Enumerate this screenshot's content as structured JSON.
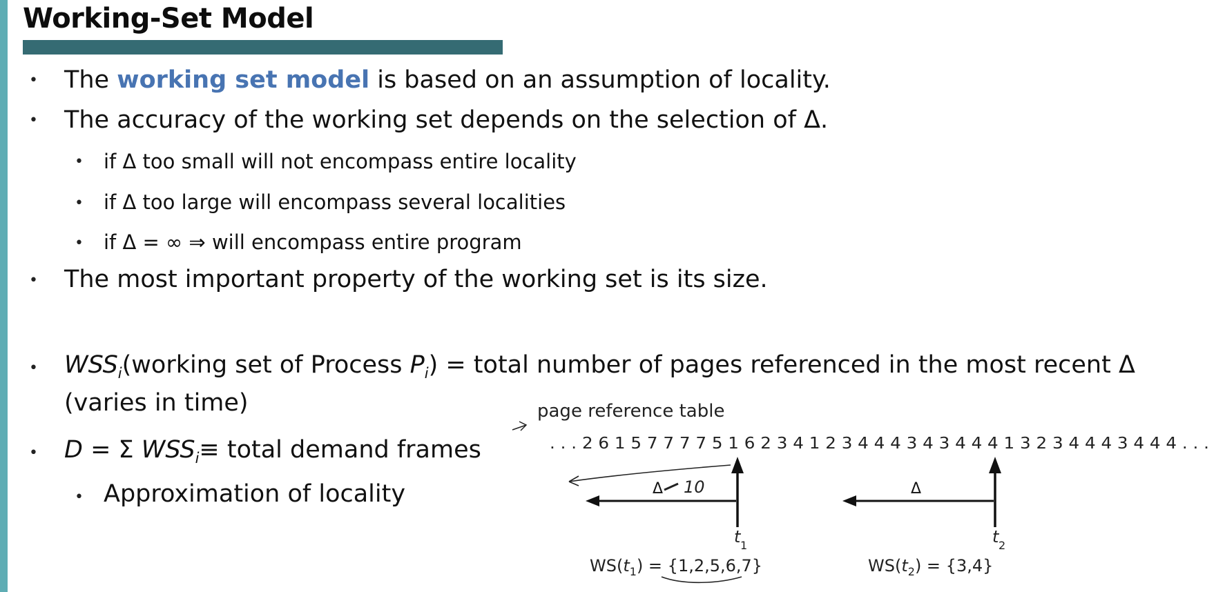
{
  "slide": {
    "title": "Working-Set Model",
    "accent_color": "#4874b2",
    "title_bar_color": "#356b73",
    "stripe_color": "#5fadb4"
  },
  "bullets": [
    {
      "pre": "The ",
      "highlight": "working set model",
      "post": " is based on an assumption of locality."
    },
    {
      "text": "The accuracy of the working set depends on the selection of Δ."
    }
  ],
  "sub_bullets": [
    "if Δ too small will not encompass entire locality",
    "if Δ too large will encompass several localities",
    "if Δ = ∞ ⇒ will encompass entire program"
  ],
  "size_bullet": "The most important property of the working set is its size.",
  "wss_bullet": {
    "wss": "WSS",
    "i": "i",
    "a": "(working set of Process ",
    "p": "P",
    "b": ") = total number of pages referenced in the most recent Δ",
    "line2": "(varies in time)"
  },
  "demand_bullet": {
    "d": "D",
    "eq": " = Σ ",
    "wss": "WSS",
    "i": "i",
    "rest": "≡ total demand frames"
  },
  "approx_bullet": "Approximation of locality",
  "diagram": {
    "caption": "page reference table",
    "reference_string": ". . . 2 6 1 5 7 7 7 7 5 1 6 2 3 4 1 2 3 4 4 4 3 4 3 4 4 4 1 3 2 3 4 4 4 3 4 4 4 . . .",
    "delta_label_1": "Δ",
    "handwritten_note": "10",
    "delta_label_2": "Δ",
    "t1": "t",
    "t1_sub": "1",
    "t2": "t",
    "t2_sub": "2",
    "ws1_prefix": "WS(",
    "ws1_t": "t",
    "ws1_sub": "1",
    "ws1_suffix": ") = {1,2,5,6,7}",
    "ws2_prefix": "WS(",
    "ws2_t": "t",
    "ws2_sub": "2",
    "ws2_suffix": ") = {3,4}"
  }
}
